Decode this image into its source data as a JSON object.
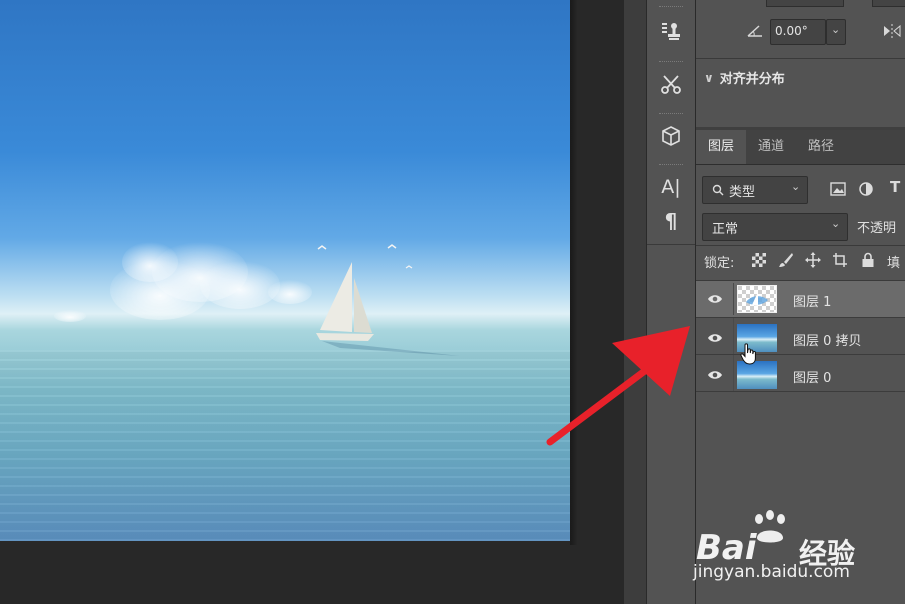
{
  "properties": {
    "angle_value": "0.00°",
    "align_section_title": "对齐并分布"
  },
  "layers_panel": {
    "tabs": [
      {
        "label": "图层",
        "active": true
      },
      {
        "label": "通道",
        "active": false
      },
      {
        "label": "路径",
        "active": false
      }
    ],
    "filter_kind": "类型",
    "blend_mode": "正常",
    "opacity_label": "不透明",
    "lock_label": "锁定:",
    "fill_label": "填",
    "layers": [
      {
        "name": "图层 1",
        "selected": true,
        "thumb": "transparent-boat"
      },
      {
        "name": "图层 0 拷贝",
        "selected": false,
        "thumb": "sea-image"
      },
      {
        "name": "图层 0",
        "selected": false,
        "thumb": "sea-image"
      }
    ]
  },
  "tools_bar": {
    "icons": [
      "clone-stamp-icon",
      "scissors-tool-icon",
      "3d-cube-icon",
      "character-panel-icon",
      "paragraph-icon"
    ],
    "character_glyph": "A|",
    "paragraph_glyph": "¶"
  },
  "watermark": {
    "logo_text_left": "Bai",
    "logo_text_right": "经验",
    "url": "jingyan.baidu.com"
  },
  "colors": {
    "panel_bg": "#535353",
    "selected_row": "#6b6b6b",
    "arrow": "#e8212a"
  }
}
